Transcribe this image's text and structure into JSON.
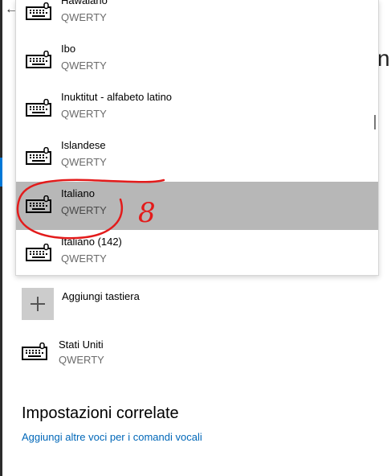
{
  "keyboard_list": {
    "items": [
      {
        "name": "Hawaiano",
        "layout": "QWERTY"
      },
      {
        "name": "Ibo",
        "layout": "QWERTY"
      },
      {
        "name": "Inuktitut - alfabeto latino",
        "layout": "QWERTY"
      },
      {
        "name": "Islandese",
        "layout": "QWERTY"
      },
      {
        "name": "Italiano",
        "layout": "QWERTY",
        "selected": true
      },
      {
        "name": "Italiano (142)",
        "layout": "QWERTY"
      }
    ]
  },
  "add_keyboard": {
    "label": "Aggiungi tastiera",
    "icon": "plus-icon"
  },
  "installed_keyboard": {
    "name": "Stati Uniti",
    "layout": "QWERTY",
    "icon": "keyboard-icon"
  },
  "related_settings": {
    "title": "Impostazioni correlate",
    "link": "Aggiungi altre voci per i comandi vocali"
  },
  "background": {
    "partial_text": "ni"
  },
  "annotation": {
    "handwritten_text": "8",
    "color": "#e31b1b"
  },
  "colors": {
    "selected_row": "#b7b7b7",
    "link": "#0067b8",
    "accent": "#0078d7"
  }
}
